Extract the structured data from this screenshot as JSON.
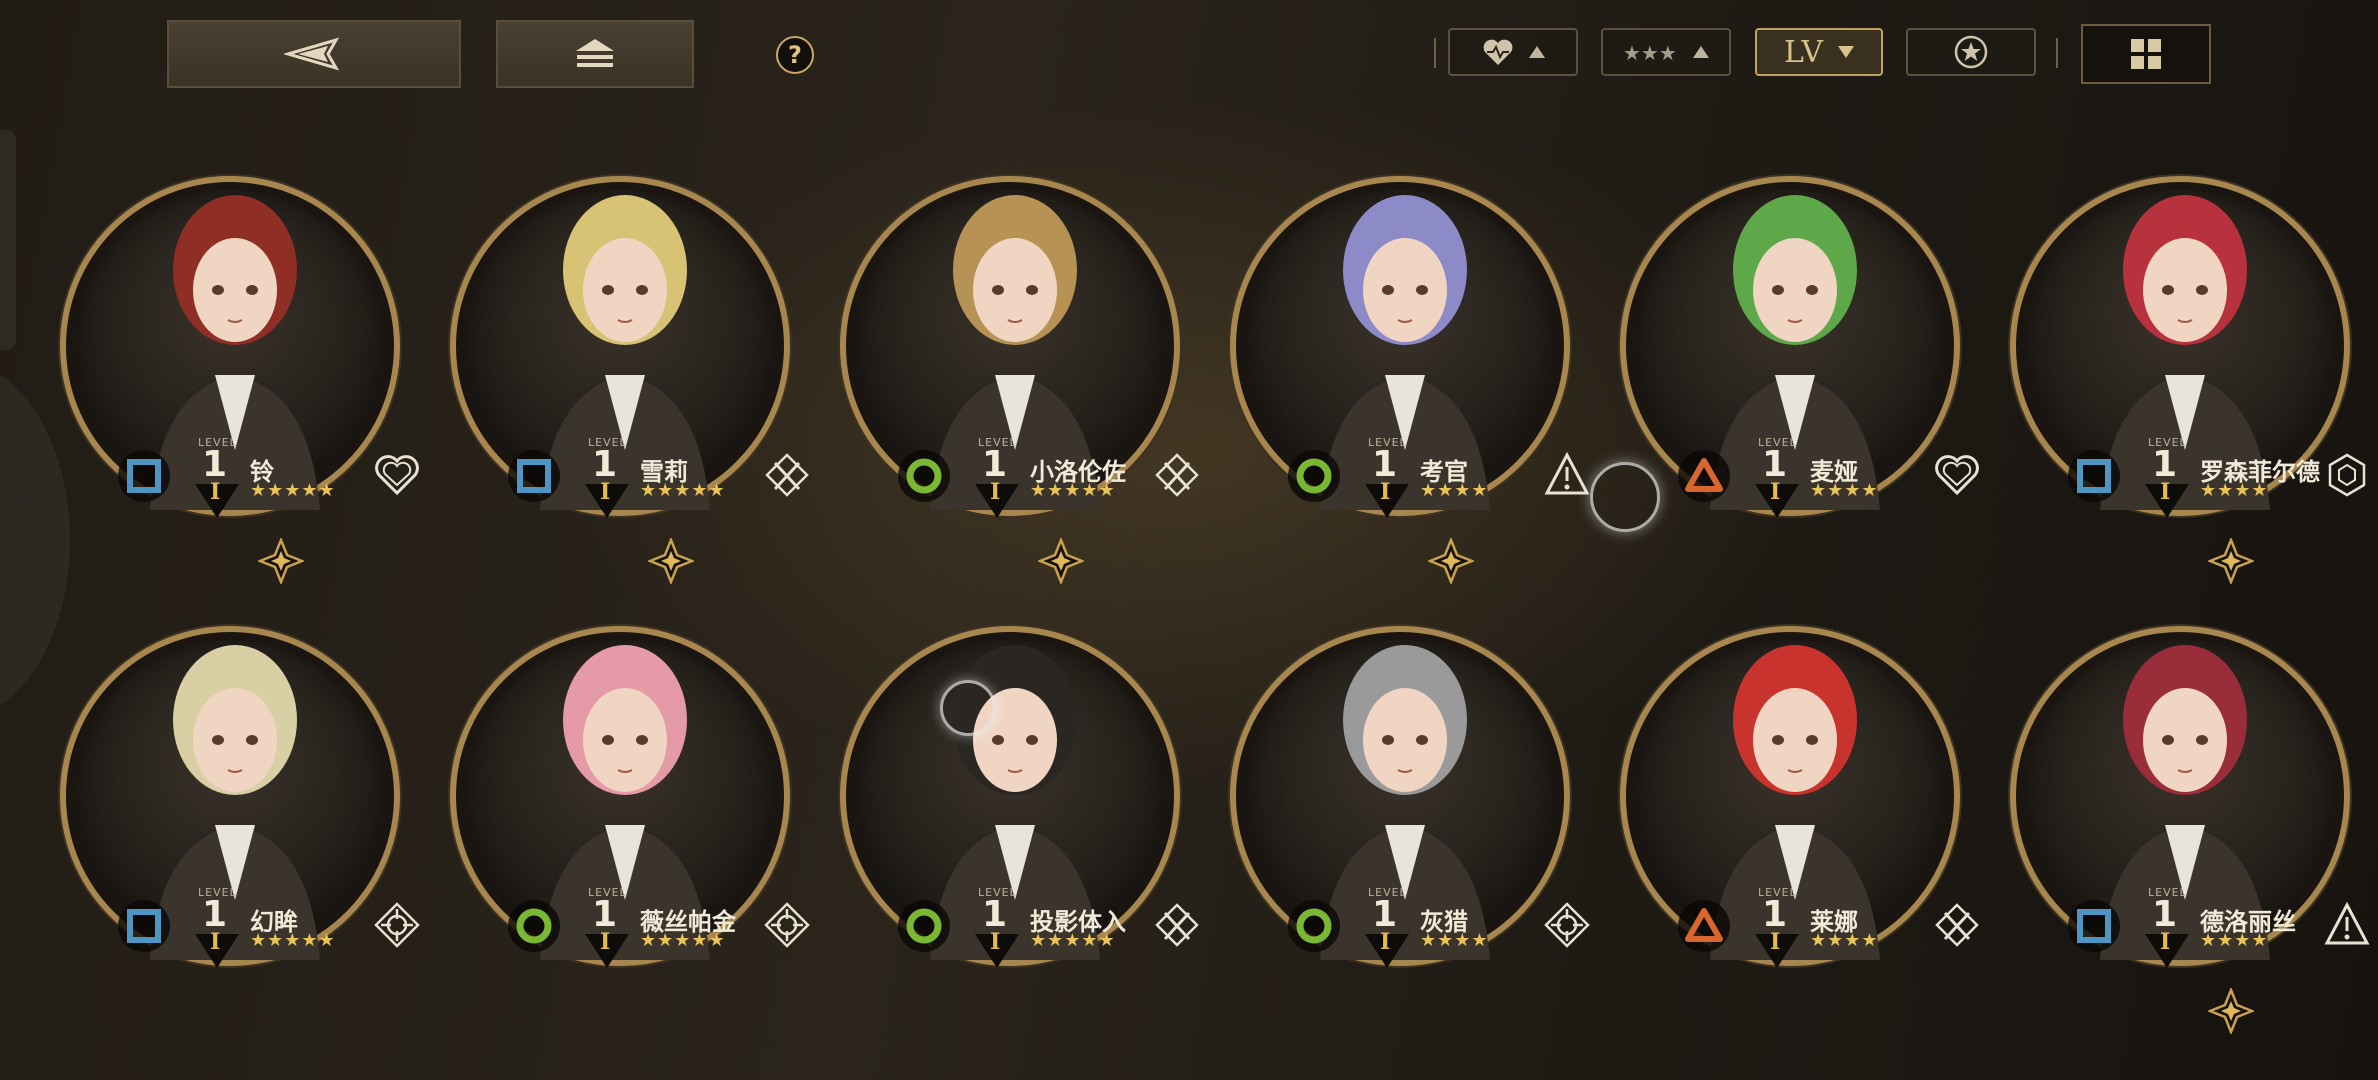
{
  "toolbar": {
    "back_icon": "back-arrow-icon",
    "home_icon": "home-stack-icon",
    "help_label": "?",
    "sort_affinity_icon": "heart-icon",
    "sort_rarity_icon": "stars-icon",
    "sort_level_label": "LV",
    "sort_element_icon": "star-emblem-icon",
    "view_icon": "grid-view-icon"
  },
  "colors": {
    "gold": "#a8874f",
    "star": "#e9c259",
    "type_blue": "#4f95c4",
    "type_green": "#7ab833",
    "type_orange": "#d9662e"
  },
  "characters": [
    {
      "name": "铃",
      "level_label": "LEVEL",
      "level": "1",
      "rank": "I",
      "stars": "★★★★★",
      "type": "square",
      "role": "heart-shield-icon",
      "portrait": "#8e2e24",
      "diamond": true
    },
    {
      "name": "雪莉",
      "level_label": "LEVEL",
      "level": "1",
      "rank": "I",
      "stars": "★★★★★",
      "type": "square",
      "role": "crossed-swords-icon",
      "portrait": "#d8c274",
      "diamond": true
    },
    {
      "name": "小洛伦佐",
      "level_label": "LEVEL",
      "level": "1",
      "rank": "I",
      "stars": "★★★★★",
      "type": "circle",
      "role": "crossed-swords-icon",
      "portrait": "#b69254",
      "diamond": true
    },
    {
      "name": "考官",
      "level_label": "LEVEL",
      "level": "1",
      "rank": "I",
      "stars": "★★★★",
      "type": "circle",
      "role": "warning-icon",
      "portrait": "#8c8bc8",
      "diamond": true
    },
    {
      "name": "麦娅",
      "level_label": "LEVEL",
      "level": "1",
      "rank": "I",
      "stars": "★★★★",
      "type": "triangle",
      "role": "heart-shield-icon",
      "portrait": "#5ea84a",
      "diamond": false
    },
    {
      "name": "罗森菲尔德",
      "level_label": "LEVEL",
      "level": "1",
      "rank": "I",
      "stars": "★★★★",
      "type": "square",
      "role": "hexagon-cluster-icon",
      "portrait": "#b8323e",
      "diamond": true
    },
    {
      "name": "幻眸",
      "level_label": "LEVEL",
      "level": "1",
      "rank": "I",
      "stars": "★★★★★",
      "type": "square",
      "role": "crosshair-icon",
      "portrait": "#d9cfa4",
      "diamond": false
    },
    {
      "name": "薇丝帕金",
      "level_label": "LEVEL",
      "level": "1",
      "rank": "I",
      "stars": "★★★★★",
      "type": "circle",
      "role": "crosshair-icon",
      "portrait": "#e59aa8",
      "diamond": false
    },
    {
      "name": "投影体入",
      "level_label": "LEVEL",
      "level": "1",
      "rank": "I",
      "stars": "★★★★★",
      "type": "circle",
      "role": "crossed-swords-icon",
      "portrait": "#2a2622",
      "diamond": false
    },
    {
      "name": "灰猎",
      "level_label": "LEVEL",
      "level": "1",
      "rank": "I",
      "stars": "★★★★",
      "type": "circle",
      "role": "crosshair-icon",
      "portrait": "#9a9a9a",
      "diamond": false
    },
    {
      "name": "莱娜",
      "level_label": "LEVEL",
      "level": "1",
      "rank": "I",
      "stars": "★★★★",
      "type": "triangle",
      "role": "crossed-swords-icon",
      "portrait": "#c9332e",
      "diamond": false
    },
    {
      "name": "德洛丽丝",
      "level_label": "LEVEL",
      "level": "1",
      "rank": "I",
      "stars": "★★★★",
      "type": "square",
      "role": "warning-icon",
      "portrait": "#9a2d3a",
      "diamond": true
    }
  ]
}
